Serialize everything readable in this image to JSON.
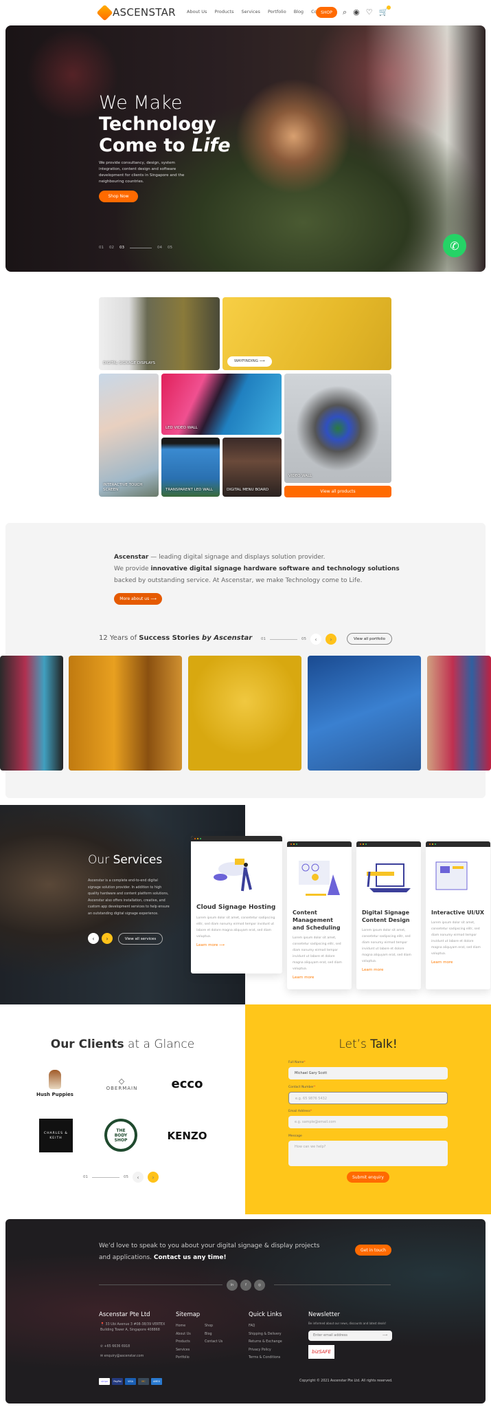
{
  "header": {
    "logo": "ASCENSTAR",
    "nav": [
      "About Us",
      "Products",
      "Services",
      "Portfolio",
      "Blog",
      "Contact Us"
    ],
    "shop": "SHOP",
    "cart_count": "0"
  },
  "hero": {
    "line1": "We Make",
    "line2": "Technology",
    "line3a": "Come to ",
    "line3b": "Life",
    "desc": "We provide consultancy, design, system integration, content design and software development for clients in Singapore and the neighbouring countries.",
    "cta": "Shop Now",
    "slides": [
      "01",
      "02",
      "03",
      "04",
      "05"
    ],
    "active_slide": 3
  },
  "products": {
    "tiles": [
      "DIGITAL SIGNAGE DISPLAYS",
      "WAYFINDING",
      "INTERACTIVE TOUCH SCREEN",
      "LED VIDEO WALL",
      "TRANSPARENT LED WALL",
      "DIGITAL MENU BOARD",
      "VIDEO WALL"
    ],
    "view_all": "View all products"
  },
  "about": {
    "brand": "Ascenstar",
    "l1": " — leading digital signage and displays solution provider.",
    "l2a": "We provide ",
    "l2b": "innovative digital signage hardware software and technology solutions",
    "l3": "backed by outstanding service. At Ascenstar, we make Technology come to Life.",
    "button": "More about us"
  },
  "portfolio": {
    "t1": "12 Years of ",
    "t2": "Success Stories",
    "t3": " by Ascenstar",
    "from": "01",
    "to": "05",
    "view_all": "View all portfolio"
  },
  "services": {
    "t1": "Our ",
    "t2": "Services",
    "desc": "Ascenstar is a complete end-to-end digital signage solution provider. In addition to high quality hardware and content platform solutions, Ascenstar also offers installation, creative, and custom app development services to help ensure an outstanding digital signage experience.",
    "view_all": "View all services",
    "cards": [
      {
        "title": "Cloud Signage Hosting",
        "body": "Lorem ipsum dolor sit amet, consetetur sadipscing elitr, sed diam nonumy eirmod tempor invidunt ut labore et dolore magna aliquyam erat, sed diam voluptua.",
        "link": "Learn more"
      },
      {
        "title": "Content Management and Scheduling",
        "body": "Lorem ipsum dolor sit amet, consetetur sadipscing elitr, sed diam nonumy eirmod tempor invidunt ut labore et dolore magna aliquyam erat, sed diam voluptua.",
        "link": "Learn more"
      },
      {
        "title": "Digital Signage Content Design",
        "body": "Lorem ipsum dolor sit amet, consetetur sadipscing elitr, sed diam nonumy eirmod tempor invidunt ut labore et dolore magna aliquyam erat, sed diam voluptua.",
        "link": "Learn more"
      },
      {
        "title": "Interactive UI/UX",
        "body": "Lorem ipsum dolor sit amet, consetetur sadipscing elitr, sed diam nonumy eirmod tempor invidunt ut labore et dolore magna aliquyam erat, sed diam voluptua.",
        "link": "Learn more"
      }
    ]
  },
  "clients": {
    "t1": "Our Clients",
    "t2": " at a Glance",
    "logos": [
      "Hush Puppies",
      "OBERMAIN",
      "ecco",
      "CHARLES & KEITH",
      "THE BODY SHOP",
      "KENZO"
    ],
    "from": "01",
    "to": "05"
  },
  "talk": {
    "t1": "Let’s ",
    "t2": "Talk!",
    "name_label": "Full Name",
    "name_value": "Michael Gary Scott",
    "phone_label": "Contact Number",
    "phone_ph": "e.g. 65 9876 5432",
    "email_label": "Email Address",
    "email_ph": "e.g. sample@email.com",
    "msg_label": "Message",
    "msg_ph": "How can we help?",
    "submit": "Submit enquiry"
  },
  "footer": {
    "cta1": "We’d love to speak to you about your digital signage & display projects and applications. ",
    "cta2": "Contact us any time!",
    "cta_btn": "Get in touch",
    "social": [
      "in",
      "f",
      "◎"
    ],
    "company": "Ascenstar Pte Ltd",
    "address": "33 Ubi Avenue 3 #08-38/39 VERTEX Building Tower A, Singapore 408868",
    "phone": "+65 6636 6918",
    "email": "enquiry@ascenstar.com",
    "sitemap_title": "Sitemap",
    "sitemap": [
      "Home",
      "About Us",
      "Products",
      "Services",
      "Portfolio",
      "Shop",
      "Blog",
      "Contact Us"
    ],
    "quick_title": "Quick Links",
    "quick": [
      "FAQ",
      "Shipping & Delivery",
      "Returns & Exchange",
      "Privacy Policy",
      "Terms & Conditions"
    ],
    "news_title": "Newsletter",
    "news_desc": "Be informed about our news, discounts and latest deals!",
    "news_ph": "Enter email address",
    "bizsafe": "bizSAFE",
    "payments": [
      "stripe",
      "PayPal",
      "VISA",
      "MC",
      "AMEX"
    ],
    "copyright": "Copyright © 2021 Ascenstar Pte Ltd. All rights reserved."
  },
  "colors": {
    "accent": "#ff6a00",
    "yellow": "#ffc61a"
  }
}
